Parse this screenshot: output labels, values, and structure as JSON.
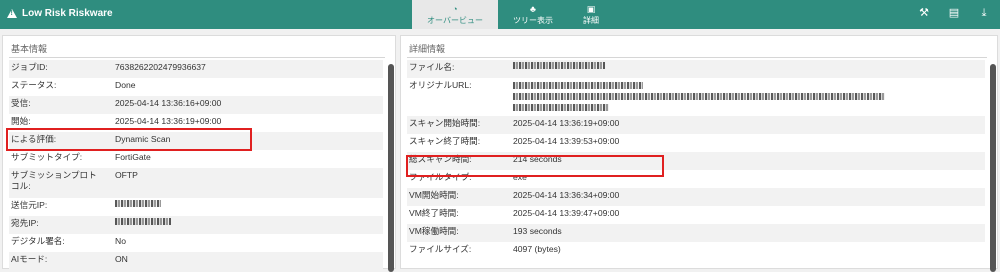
{
  "app": {
    "title": "Low Risk Riskware"
  },
  "tabs": [
    {
      "label": "オーバービュー",
      "icon": "dashboard-icon"
    },
    {
      "label": "ツリー表示",
      "icon": "tree-icon"
    },
    {
      "label": "詳細",
      "icon": "detail-icon"
    }
  ],
  "toolbar_icons": [
    "hammer-icon",
    "pdf-icon",
    "download-icon"
  ],
  "left_panel": {
    "title": "基本情報",
    "rows": [
      {
        "label": "ジョブID:",
        "value": "7638262202479936637"
      },
      {
        "label": "ステータス:",
        "value": "Done"
      },
      {
        "label": "受信:",
        "value": "2025-04-14 13:36:16+09:00"
      },
      {
        "label": "開始:",
        "value": "2025-04-14 13:36:19+09:00"
      },
      {
        "label": "による評価:",
        "value": "Dynamic Scan"
      },
      {
        "label": "サブミットタイプ:",
        "value": "FortiGate"
      },
      {
        "label": "サブミッションプロトコル:",
        "value": "OFTP"
      },
      {
        "label": "送信元IP:",
        "value": ""
      },
      {
        "label": "宛先IP:",
        "value": ""
      },
      {
        "label": "デジタル署名:",
        "value": "No"
      },
      {
        "label": "AIモード:",
        "value": "ON"
      }
    ]
  },
  "right_panel": {
    "title": "詳細情報",
    "rows": [
      {
        "label": "ファイル名:",
        "value": ""
      },
      {
        "label": "オリジナルURL:",
        "value": ""
      },
      {
        "label": "スキャン開始時間:",
        "value": "2025-04-14 13:36:19+09:00"
      },
      {
        "label": "スキャン終了時間:",
        "value": "2025-04-14 13:39:53+09:00"
      },
      {
        "label": "総スキャン時間:",
        "value": "214 seconds"
      },
      {
        "label": "ファイルタイプ:",
        "value": "exe"
      },
      {
        "label": "VM開始時間:",
        "value": "2025-04-14 13:36:34+09:00"
      },
      {
        "label": "VM終了時間:",
        "value": "2025-04-14 13:39:47+09:00"
      },
      {
        "label": "VM稼働時間:",
        "value": "193 seconds"
      },
      {
        "label": "ファイルサイズ:",
        "value": "4097 (bytes)"
      }
    ]
  },
  "colors": {
    "header": "#2f8d7f",
    "highlight": "#e02020"
  }
}
